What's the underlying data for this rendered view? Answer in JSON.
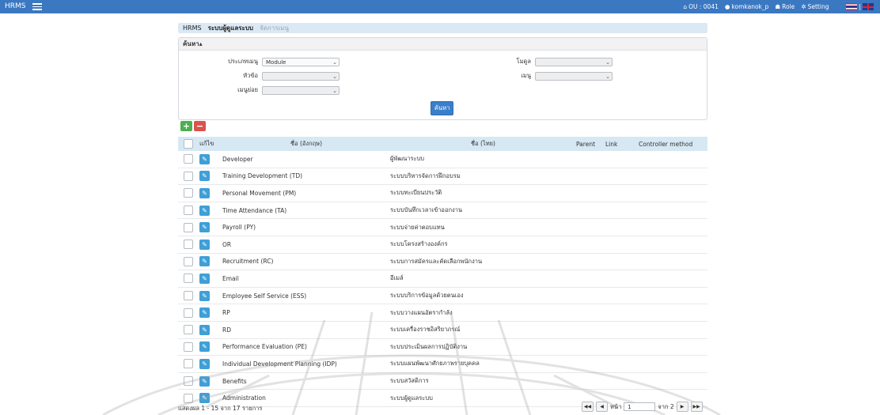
{
  "topbar": {
    "brand": "HRMS",
    "ou": "OU : 0041",
    "user": "komkanok_p",
    "role": "Role",
    "setting": "Setting",
    "lang_separator": "|"
  },
  "breadcrumb": [
    "HRMS",
    "ระบบผู้ดูแลระบบ",
    "จัดการเมนู"
  ],
  "search": {
    "header": "ค้นหา",
    "fields": {
      "menu_type": {
        "label": "ประเภทเมนู",
        "value": "Module"
      },
      "module": {
        "label": "โมดูล",
        "value": ""
      },
      "topic": {
        "label": "หัวข้อ",
        "value": ""
      },
      "menu": {
        "label": "เมนู",
        "value": ""
      },
      "submenu": {
        "label": "เมนูย่อย",
        "value": ""
      }
    },
    "button": "ค้นหา"
  },
  "table": {
    "columns": {
      "edit": "แก้ไข",
      "name_en": "ชื่อ (อังกฤษ)",
      "name_th": "ชื่อ (ไทย)",
      "parent": "Parent",
      "link": "Link",
      "controller": "Controller method"
    },
    "rows": [
      {
        "en": "Developer",
        "th": "ผู้พัฒนาระบบ"
      },
      {
        "en": "Training Development (TD)",
        "th": "ระบบบริหารจัดการฝึกอบรม"
      },
      {
        "en": "Personal Movement (PM)",
        "th": "ระบบทะเบียนประวัติ"
      },
      {
        "en": "Time Attendance (TA)",
        "th": "ระบบบันทึกเวลาเข้าออกงาน"
      },
      {
        "en": "Payroll (PY)",
        "th": "ระบบจ่ายค่าตอบแทน"
      },
      {
        "en": "OR",
        "th": "ระบบโครงสร้างองค์กร"
      },
      {
        "en": "Recruitment (RC)",
        "th": "ระบบการสมัครและคัดเลือกพนักงาน"
      },
      {
        "en": "Email",
        "th": "อีเมล์"
      },
      {
        "en": "Employee Self Service (ESS)",
        "th": "ระบบบริการข้อมูลด้วยตนเอง"
      },
      {
        "en": "RP",
        "th": "ระบบวางแผนอัตรากำลัง"
      },
      {
        "en": "RD",
        "th": "ระบบเครื่องราชอิสริยาภรณ์"
      },
      {
        "en": "Performance Evaluation (PE)",
        "th": "ระบบประเมินผลการปฏิบัติงาน"
      },
      {
        "en": "Individual Development Planning (IDP)",
        "th": "ระบบแผนพัฒนาศักยภาพรายบุคคล"
      },
      {
        "en": "Benefits",
        "th": "ระบบสวัสดิการ"
      },
      {
        "en": "Administration",
        "th": "ระบบผู้ดูแลระบบ"
      }
    ]
  },
  "footer": {
    "summary": "แสดงผล 1 - 15 จาก 17 รายการ"
  },
  "pager": {
    "page_label": "หน้า",
    "page_value": "1",
    "of_label": "จาก 2"
  },
  "colors": {
    "topbar": "#3b78c2",
    "breadcrumb_bg": "#dbe9f5",
    "table_header": "#d6e8f3",
    "edit_button": "#3f9fd6",
    "add": "#4caf50",
    "remove": "#d9534f"
  }
}
